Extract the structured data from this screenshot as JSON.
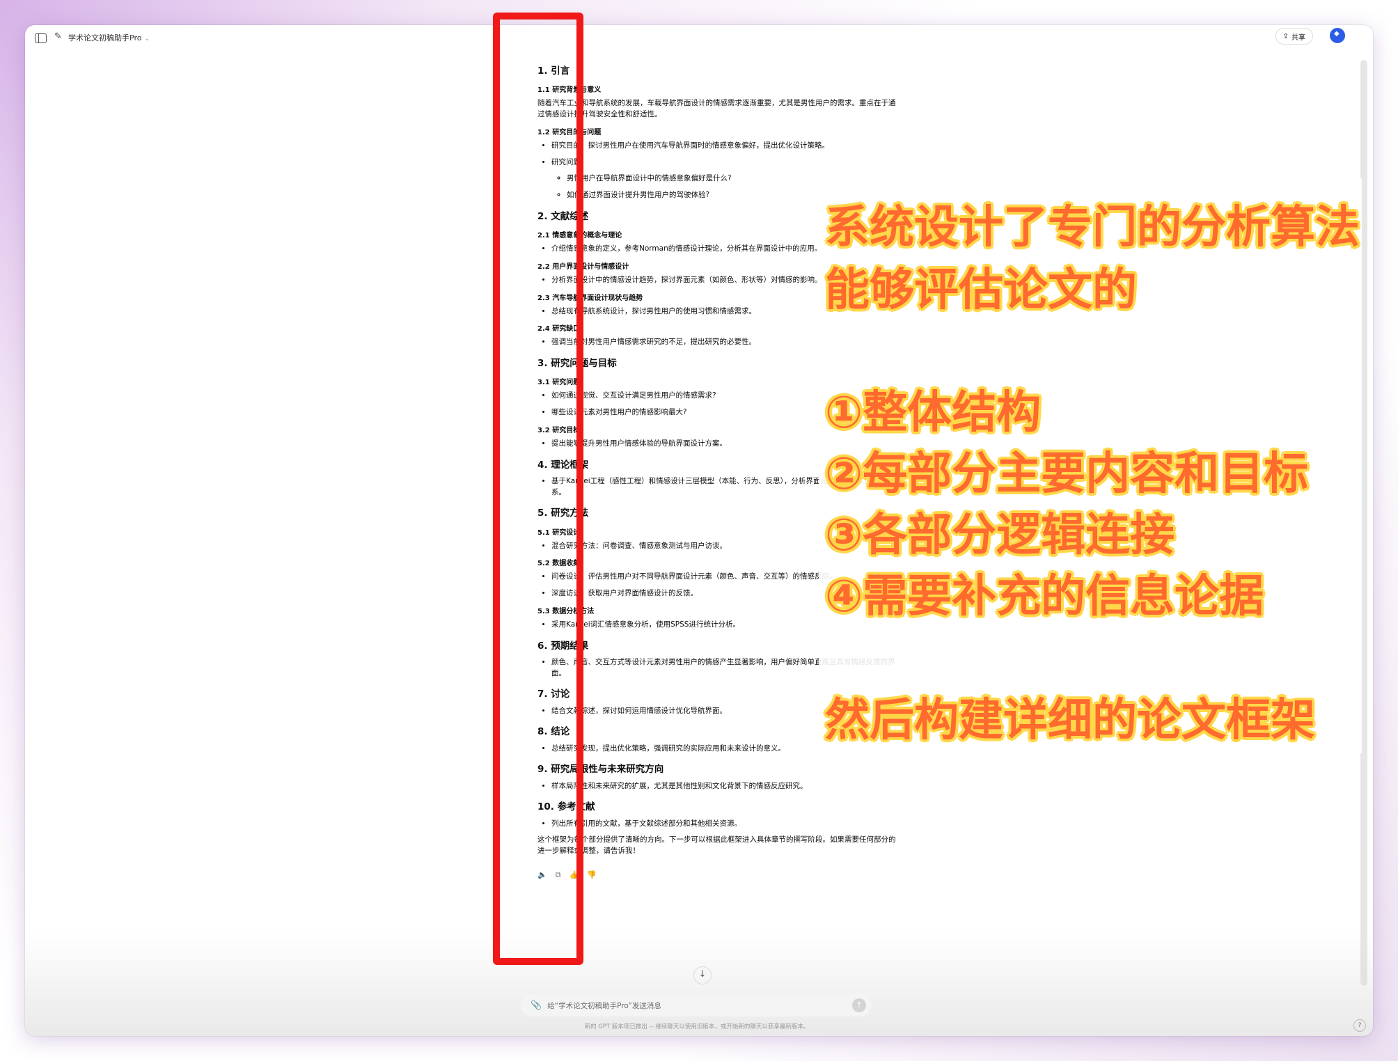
{
  "header": {
    "app_title": "学术论文初稿助手Pro",
    "share_label": "共享"
  },
  "doc": {
    "s1": {
      "title": "1. 引言",
      "s1_1": {
        "title": "1.1 研究背景与意义",
        "text": "随着汽车工业和导航系统的发展，车载导航界面设计的情感需求逐渐重要，尤其是男性用户的需求。重点在于通过情感设计提升驾驶安全性和舒适性。"
      },
      "s1_2": {
        "title": "1.2 研究目的与问题",
        "b1": "研究目的：探讨男性用户在使用汽车导航界面时的情感意象偏好，提出优化设计策略。",
        "b2": "研究问题：",
        "sb1": "男性用户在导航界面设计中的情感意象偏好是什么?",
        "sb2": "如何通过界面设计提升男性用户的驾驶体验?"
      }
    },
    "s2": {
      "title": "2. 文献综述",
      "s2_1": {
        "title": "2.1 情感意象的概念与理论",
        "b1": "介绍情感意象的定义，参考Norman的情感设计理论，分析其在界面设计中的应用。"
      },
      "s2_2": {
        "title": "2.2 用户界面设计与情感设计",
        "b1": "分析界面设计中的情感设计趋势，探讨界面元素（如颜色、形状等）对情感的影响。"
      },
      "s2_3": {
        "title": "2.3 汽车导航界面设计现状与趋势",
        "b1": "总结现有导航系统设计，探讨男性用户的使用习惯和情感需求。"
      },
      "s2_4": {
        "title": "2.4 研究缺口",
        "b1": "强调当前对男性用户情感需求研究的不足，提出研究的必要性。"
      }
    },
    "s3": {
      "title": "3. 研究问题与目标",
      "s3_1": {
        "title": "3.1 研究问题",
        "b1": "如何通过视觉、交互设计满足男性用户的情感需求?",
        "b2": "哪些设计元素对男性用户的情感影响最大?"
      },
      "s3_2": {
        "title": "3.2 研究目标",
        "b1": "提出能够提升男性用户情感体验的导航界面设计方案。"
      }
    },
    "s4": {
      "title": "4. 理论框架",
      "b1": "基于Kansei工程（感性工程）和情感设计三层模型（本能、行为、反思），分析界面元素与情感反应的关系。"
    },
    "s5": {
      "title": "5. 研究方法",
      "s5_1": {
        "title": "5.1 研究设计",
        "b1": "混合研究方法：问卷调查、情感意象测试与用户访谈。"
      },
      "s5_2": {
        "title": "5.2 数据收集",
        "b1": "问卷设计：评估男性用户对不同导航界面设计元素（颜色、声音、交互等）的情感反应。",
        "b2": "深度访谈：获取用户对界面情感设计的反馈。"
      },
      "s5_3": {
        "title": "5.3 数据分析方法",
        "b1": "采用Kansei词汇情感意象分析，使用SPSS进行统计分析。"
      }
    },
    "s6": {
      "title": "6. 预期结果",
      "b1": "颜色、声音、交互方式等设计元素对男性用户的情感产生显著影响，用户偏好简单直观且具有情感反馈的界面。"
    },
    "s7": {
      "title": "7. 讨论",
      "b1": "结合文献综述，探讨如何运用情感设计优化导航界面。"
    },
    "s8": {
      "title": "8. 结论",
      "b1": "总结研究发现，提出优化策略，强调研究的实际应用和未来设计的意义。"
    },
    "s9": {
      "title": "9. 研究局限性与未来研究方向",
      "b1": "样本局限性和未来研究的扩展，尤其是其他性别和文化背景下的情感反应研究。"
    },
    "s10": {
      "title": "10. 参考文献",
      "b1": "列出所有引用的文献，基于文献综述部分和其他相关资源。"
    },
    "closing": "这个框架为每个部分提供了清晰的方向。下一步可以根据此框架进入具体章节的撰写阶段。如果需要任何部分的进一步解释或调整，请告诉我！"
  },
  "annotation": {
    "line1": "系统设计了专门的分析算法",
    "line2": "能够评估论文的",
    "item1": "①整体结构",
    "item2": "②每部分主要内容和目标",
    "item3": "③各部分逻辑连接",
    "item4": "④需要补充的信息论据",
    "line3": "然后构建详细的论文框架"
  },
  "composer": {
    "placeholder": "给“学术论文初稿助手Pro”发送消息",
    "footer_note": "新的 GPT 版本现已推出 -- 继续聊天以使用旧版本，或开始新的聊天以获享最新版本。"
  },
  "colors": {
    "red_box": "#f01818",
    "annotation_fill": "#ff6a2e",
    "annotation_outline": "#ffd84a",
    "accent": "#2b5ce6"
  },
  "icons": [
    "sidebar-toggle-icon",
    "edit-icon",
    "chevron-down-icon",
    "share-icon",
    "avatar-icon",
    "speaker-icon",
    "copy-icon",
    "thumbs-up-icon",
    "thumbs-down-icon",
    "arrow-down-icon",
    "paperclip-icon",
    "send-arrow-icon",
    "help-icon"
  ]
}
